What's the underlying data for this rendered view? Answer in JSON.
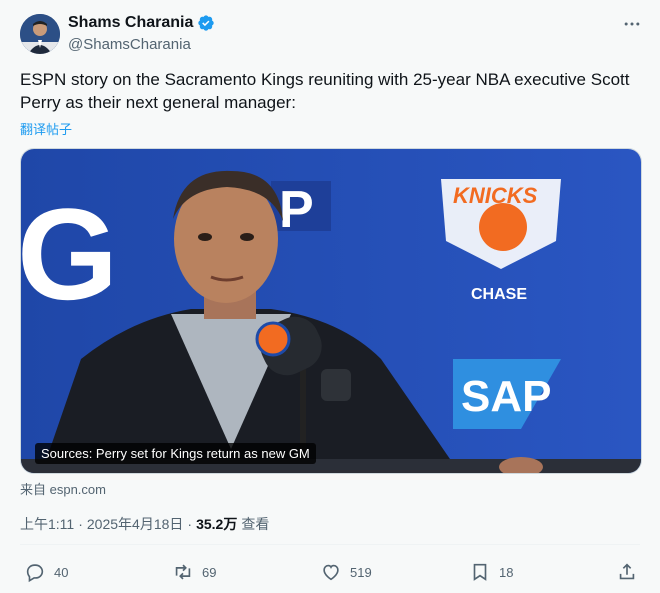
{
  "author": {
    "name": "Shams Charania",
    "handle": "@ShamsCharania",
    "verified": true
  },
  "tweet": {
    "text": "ESPN story on the Sacramento Kings reuniting with 25-year NBA executive Scott Perry as their next general manager:",
    "translate_link": "翻译帖子"
  },
  "media": {
    "caption": "Sources: Perry set for Kings return as new GM",
    "source": "来自 espn.com",
    "backdrop_letters": [
      "G",
      "P",
      "SAP"
    ],
    "backdrop_logo_text": "KNICKS",
    "backdrop_sponsor": "CHASE"
  },
  "meta": {
    "time": "上午1:11",
    "separator": "·",
    "date": "2025年4月18日",
    "views": "35.2万",
    "views_label": "查看"
  },
  "actions": {
    "replies": "40",
    "retweets": "69",
    "likes": "519",
    "bookmarks": "18"
  },
  "icons": [
    "verified-badge-icon",
    "more-icon",
    "reply-icon",
    "retweet-icon",
    "like-icon",
    "bookmark-icon",
    "share-icon"
  ],
  "colors": {
    "accent": "#1d9bf0",
    "text": "#0f1419",
    "muted": "#536471",
    "background": "#f7f9f9"
  }
}
